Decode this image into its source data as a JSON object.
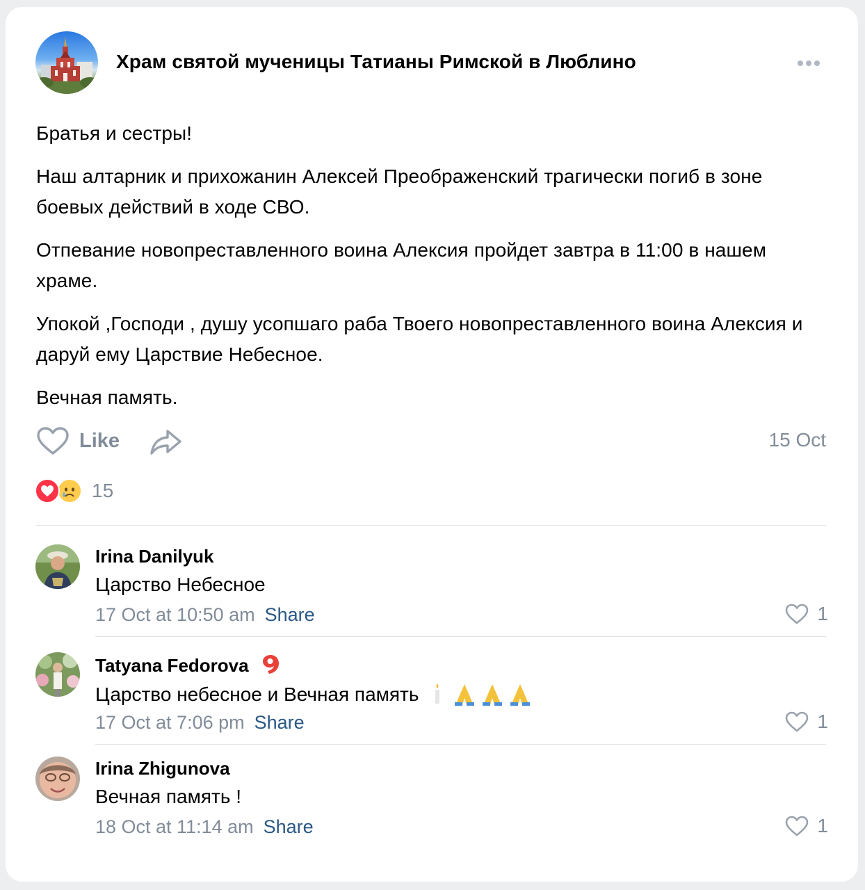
{
  "post": {
    "group_name": "Храм святой мученицы Татианы Римской в Люблино",
    "paragraphs": [
      "Братья и сестры!",
      "Наш алтарник и прихожанин Алексей Преображенский трагически погиб в зоне боевых действий в ходе СВО.",
      "Отпевание новопреставленного воина Алексия пройдет завтра в 11:00 в нашем храме.",
      "Упокой ,Господи , душу усопшаго раба Твоего новопреставленного воина Алексия и даруй ему Царствие Небесное.",
      "Вечная память."
    ],
    "like_label": "Like",
    "date": "15 Oct",
    "reaction_count": "15"
  },
  "comments": [
    {
      "author": "Irina Danilyuk",
      "text": "Царство Небесное",
      "date": "17 Oct at 10:50 am",
      "share_label": "Share",
      "likes": "1"
    },
    {
      "author": "Tatyana Fedorova",
      "text": "Царство небесное и Вечная память",
      "date": "17 Oct at 7:06 pm",
      "share_label": "Share",
      "likes": "1"
    },
    {
      "author": "Irina Zhigunova",
      "text": "Вечная память !",
      "date": "18 Oct at 11:14 am",
      "share_label": "Share",
      "likes": "1"
    }
  ],
  "icons": {
    "more": "more-horizontal-icon",
    "like": "heart-outline-icon",
    "share": "share-arrow-icon",
    "reaction_1": "red-heart-icon",
    "reaction_2": "crying-face-icon",
    "badge": "nine-badge-icon",
    "candle": "candle-icon",
    "pray": "folded-hands-icon"
  },
  "colors": {
    "background": "#edeef0",
    "card": "#ffffff",
    "secondary_text": "#818c99",
    "link": "#2a5885",
    "reaction_heart": "#ff3347"
  }
}
